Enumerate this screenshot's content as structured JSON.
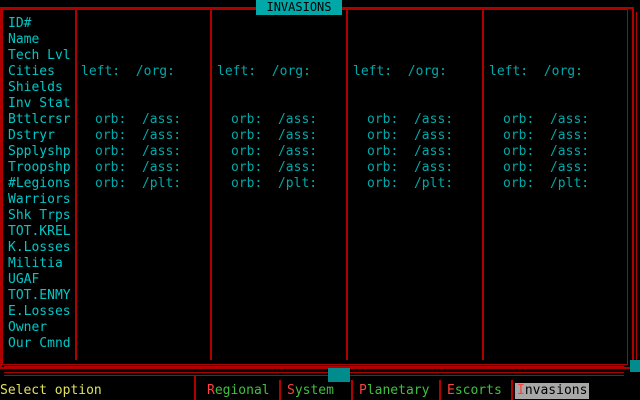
{
  "title": "INVASIONS",
  "row_labels": [
    "ID#",
    "Name",
    "Tech Lvl",
    "Cities",
    "Shields",
    "Inv Stat",
    "Bttlcrsr",
    "Dstryr",
    "Spplyshp",
    "Troopshp",
    "#Legions",
    "Warriors",
    "Shk Trps",
    "TOT.KREL",
    "K.Losses",
    "Militia",
    "UGAF",
    "TOT.ENMY",
    "E.Losses",
    "Owner",
    "Our Cmnd"
  ],
  "columns": [
    {
      "cities": "left:  /org:",
      "ships": [
        "orb:  /ass:",
        "orb:  /ass:",
        "orb:  /ass:",
        "orb:  /ass:"
      ],
      "legions": "orb:  /plt:"
    },
    {
      "cities": "left:  /org:",
      "ships": [
        "orb:  /ass:",
        "orb:  /ass:",
        "orb:  /ass:",
        "orb:  /ass:"
      ],
      "legions": "orb:  /plt:"
    },
    {
      "cities": "left:  /org:",
      "ships": [
        "orb:  /ass:",
        "orb:  /ass:",
        "orb:  /ass:",
        "orb:  /ass:"
      ],
      "legions": "orb:  /plt:"
    },
    {
      "cities": "left:  /org:",
      "ships": [
        "orb:  /ass:",
        "orb:  /ass:",
        "orb:  /ass:",
        "orb:  /ass:"
      ],
      "legions": "orb:  /plt:"
    }
  ],
  "status_text": "Select option",
  "menu": [
    {
      "hotkey": "R",
      "rest": "egional"
    },
    {
      "hotkey": "S",
      "rest": "ystem"
    },
    {
      "hotkey": "P",
      "rest": "lanetary"
    },
    {
      "hotkey": "E",
      "rest": "scorts"
    },
    {
      "hotkey": "I",
      "rest": "nvasions",
      "active": true
    }
  ],
  "colors": {
    "frame": "#b00000",
    "label": "#00c8c8",
    "value": "#00a8a8",
    "title_bg": "#00a8a8",
    "status": "#e0e060",
    "hotkey": "#ff4040"
  }
}
